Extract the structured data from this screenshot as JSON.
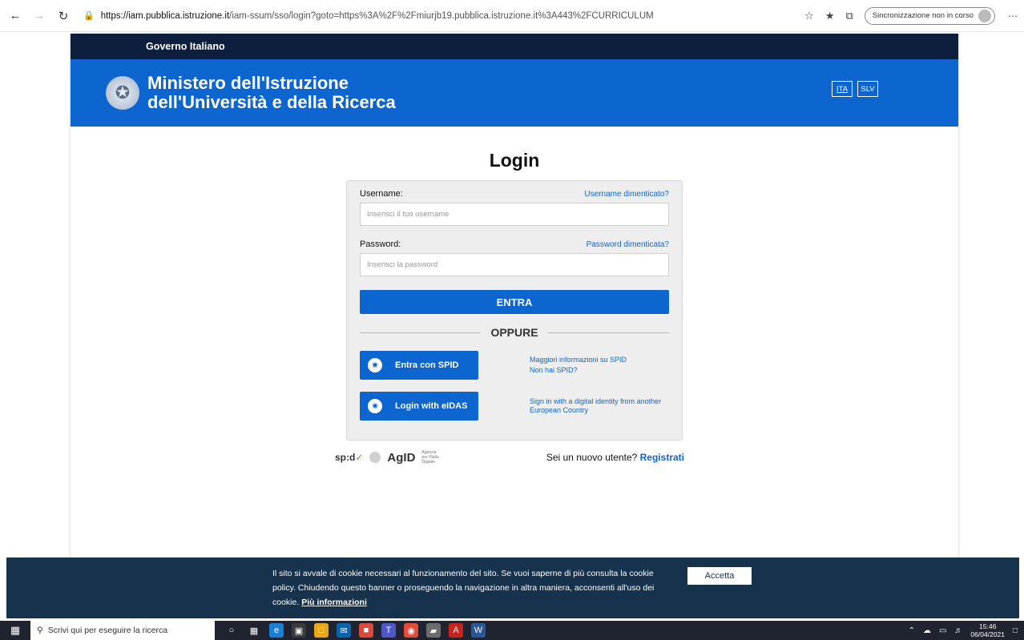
{
  "browser": {
    "url_domain": "https://iam.pubblica.istruzione.it",
    "url_path": "/iam-ssum/sso/login?goto=https%3A%2F%2Fmiurjb19.pubblica.istruzione.it%3A443%2FCURRICULUM",
    "sync_label": "Sincronizzazione non in corso"
  },
  "header": {
    "gov_strip": "Governo Italiano",
    "ministry_line1": "Ministero dell'Istruzione",
    "ministry_line2": "dell'Università e della Ricerca",
    "lang_ita": "ITA",
    "lang_slv": "SLV"
  },
  "login": {
    "title": "Login",
    "username_label": "Username:",
    "username_forgot": "Username dimenticato?",
    "username_placeholder": "Inserisci il tuo username",
    "password_label": "Password:",
    "password_forgot": "Password dimenticata?",
    "password_placeholder": "Inserisci la password",
    "enter_label": "ENTRA",
    "or_label": "OPPURE",
    "spid_button": "Entra con SPID",
    "spid_info": "Maggiori informazioni su SPID",
    "spid_none": "Non hai SPID?",
    "eidas_button": "Login with eIDAS",
    "eidas_info": "Sign in with a digital identity from another European Country"
  },
  "footer": {
    "spid_logo": "sp:d",
    "agid_logo": "AgID",
    "agid_sub": "Agenzia per l'Italia Digitale",
    "new_user": "Sei un nuovo utente?",
    "register": "Registrati"
  },
  "cookie": {
    "text": "Il sito si avvale di cookie necessari al funzionamento del sito. Se vuoi saperne di più consulta la cookie policy. Chiudendo questo banner o proseguendo la navigazione in altra maniera, acconsenti all'uso dei cookie.",
    "more": "Più informazioni",
    "accept": "Accetta"
  },
  "taskbar": {
    "search_placeholder": "Scrivi qui per eseguire la ricerca",
    "time": "15:46",
    "date": "06/04/2021"
  },
  "colors": {
    "gov_dark": "#0d1f3c",
    "ministry_blue": "#0d66d0",
    "cookie_bg": "#17324d"
  }
}
